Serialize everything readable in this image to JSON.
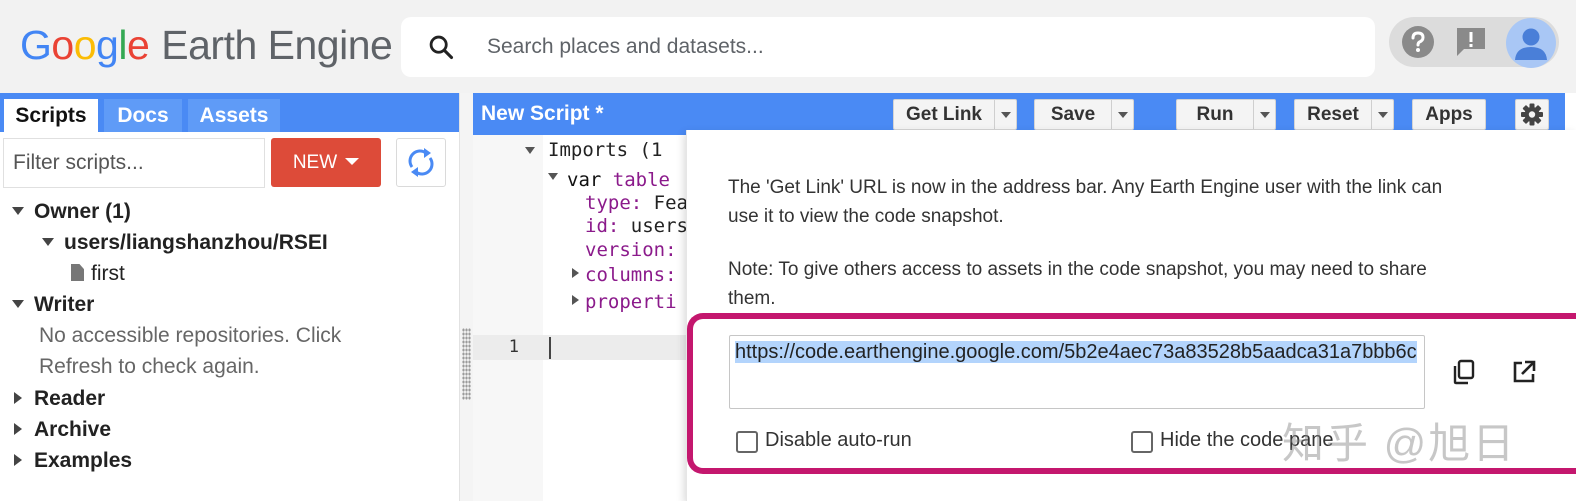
{
  "header": {
    "logo_letters": [
      "G",
      "o",
      "o",
      "g",
      "l",
      "e"
    ],
    "logo_product": "Earth Engine",
    "search_placeholder": "Search places and datasets..."
  },
  "left_panel": {
    "tabs": [
      {
        "label": "Scripts",
        "active": true
      },
      {
        "label": "Docs",
        "active": false
      },
      {
        "label": "Assets",
        "active": false
      }
    ],
    "filter_placeholder": "Filter scripts...",
    "new_button": "NEW",
    "tree": {
      "owner": "Owner (1)",
      "owner_repo": "users/liangshanzhou/RSEI",
      "owner_file": "first",
      "writer": "Writer",
      "writer_msg_1": "No accessible repositories. Click",
      "writer_msg_2": "Refresh to check again.",
      "reader": "Reader",
      "archive": "Archive",
      "examples": "Examples"
    }
  },
  "editor": {
    "title": "New Script *",
    "buttons": {
      "get_link": "Get Link",
      "save": "Save",
      "run": "Run",
      "reset": "Reset",
      "apps": "Apps"
    },
    "imports": {
      "header": "Imports (1",
      "var_kw": "var",
      "var_name": "table",
      "type_key": "type:",
      "type_val": "Fea",
      "id_key": "id:",
      "id_val": "users",
      "version_key": "version:",
      "columns_key": "columns:",
      "properties_key": "properti"
    },
    "line_number": "1"
  },
  "get_link_popup": {
    "para1_line1": "The 'Get Link' URL is now in the address bar. Any Earth Engine user with the link can",
    "para1_line2": "use it to view the code snapshot.",
    "para2_line1": "Note: To give others access to assets in the code snapshot, you may need to share",
    "para2_line2": "them.",
    "url": "https://code.earthengine.google.com/5b2e4aec73a83528b5aadca31a7bbb6c",
    "disable_autorun": "Disable auto-run",
    "hide_code_pane": "Hide the code pane"
  },
  "watermark": "知乎 @旭日",
  "colors": {
    "accent_blue": "#4a8af4",
    "new_button_red": "#dd4b39",
    "highlight_magenta": "#c4176e"
  }
}
